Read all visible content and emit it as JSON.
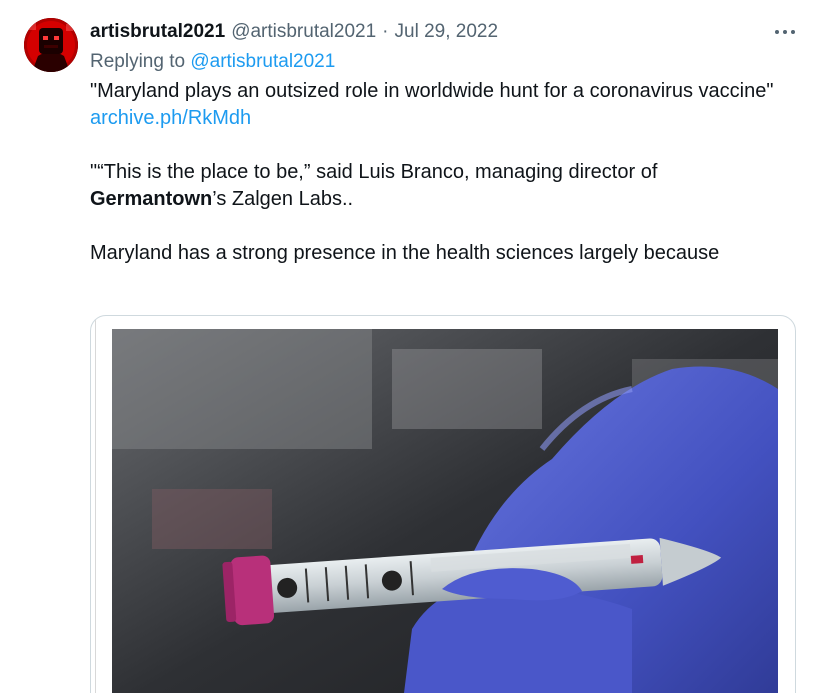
{
  "tweet": {
    "display_name": "artisbrutal2021",
    "handle": "@artisbrutal2021",
    "separator": "·",
    "date": "Jul 29, 2022",
    "replying_prefix": "Replying to ",
    "replying_to": "@artisbrutal2021",
    "line1": "\"Maryland plays an outsized role in worldwide hunt for a coronavirus vaccine\"",
    "link": "archive.ph/RkMdh",
    "quote_part1": "\"“This is the place to be,” said Luis Branco, managing director of ",
    "quote_bold": "Germantown",
    "quote_part2": "’s Zalgen Labs..",
    "line3": "Maryland has a strong presence in the health sciences largely because"
  },
  "icons": {
    "more": "more-horizontal-icon"
  },
  "colors": {
    "link": "#1d9bf0",
    "secondary_text": "#536471",
    "glove": "#4b57c6",
    "tube_cap": "#b8307a"
  }
}
